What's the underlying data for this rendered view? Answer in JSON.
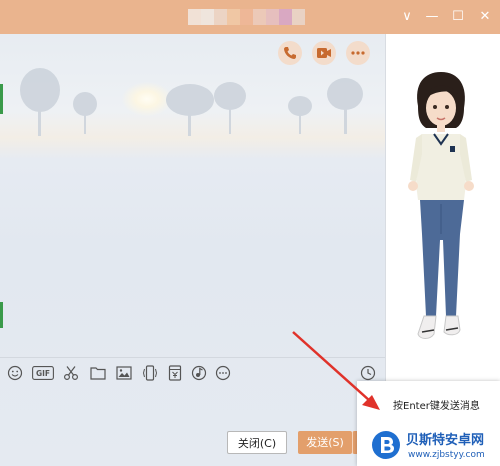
{
  "window": {
    "title_colors": [
      "#f1e1d6",
      "#efe5dd",
      "#ecd4c4",
      "#f0c7a4",
      "#eeb797",
      "#ecc9b8",
      "#e6bfbe",
      "#d9a8c2",
      "#e9d2c4"
    ],
    "accent": "#eab48e"
  },
  "titlebar_controls": {
    "dropdown_icon": "∨",
    "minimize_icon": "—",
    "maximize_icon": "☐",
    "close_icon": "✕"
  },
  "chat_actions": {
    "icons": [
      "phone-icon",
      "video-icon",
      "more-icon"
    ]
  },
  "toolbar": {
    "icons": [
      "emoji-icon",
      "gif-icon",
      "scissors-icon",
      "folder-icon",
      "image-icon",
      "shake-icon",
      "red-packet-icon",
      "music-icon",
      "more-icon",
      "history-icon"
    ],
    "gif_label": "GIF"
  },
  "buttons": {
    "close_label": "关闭(C)",
    "send_label": "发送(S)",
    "send_arrow": "▾",
    "send_color": "#e39f6b"
  },
  "tooltip": {
    "text": "按Enter键发送消息"
  },
  "watermark": {
    "title": "贝斯特安卓网",
    "url": "www.zjbstyy.com"
  }
}
